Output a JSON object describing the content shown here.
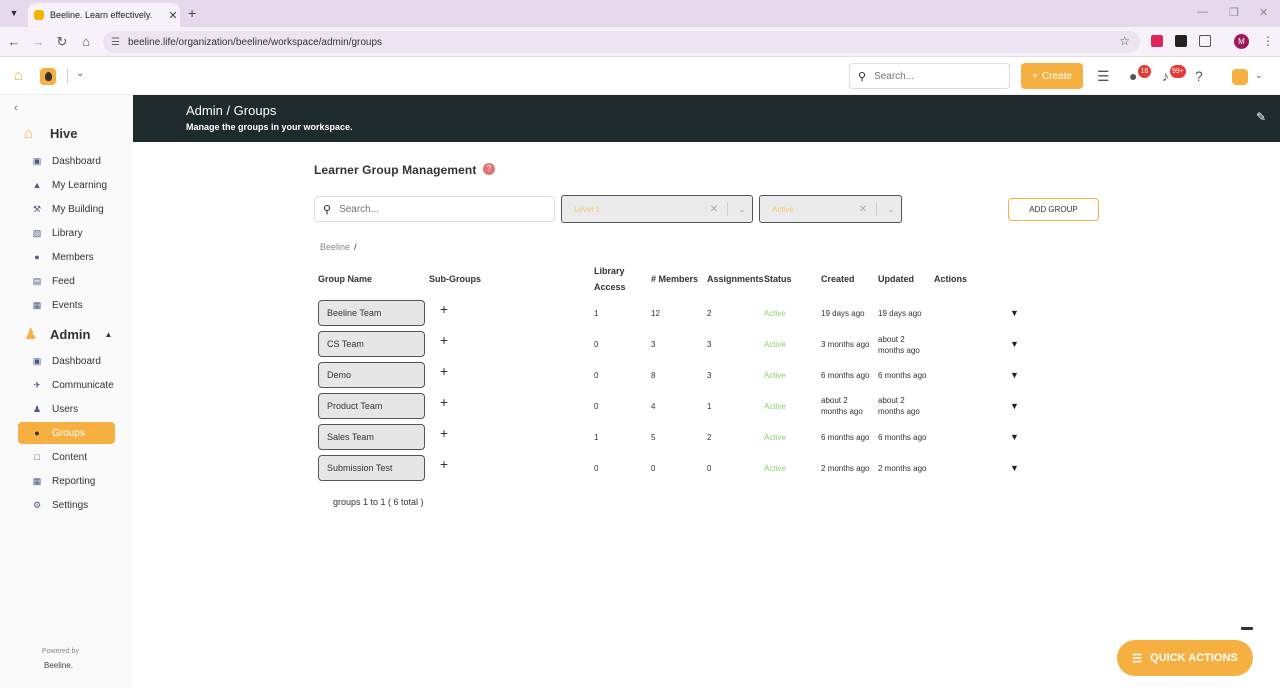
{
  "browser": {
    "tab_title": "Beeline. Learn effectively.",
    "url": "beeline.life/organization/beeline/workspace/admin/groups"
  },
  "header": {
    "search_placeholder": "Search...",
    "create_label": "Create",
    "notifications_badge": "16",
    "alerts_badge": "99+"
  },
  "sidebar": {
    "hive_label": "Hive",
    "hive_items": [
      {
        "label": "Dashboard",
        "icon": "chart-icon"
      },
      {
        "label": "My Learning",
        "icon": "graduation-cap-icon"
      },
      {
        "label": "My Building",
        "icon": "hammer-icon"
      },
      {
        "label": "Library",
        "icon": "book-icon"
      },
      {
        "label": "Members",
        "icon": "users-icon"
      },
      {
        "label": "Feed",
        "icon": "feed-icon"
      },
      {
        "label": "Events",
        "icon": "calendar-icon"
      }
    ],
    "admin_label": "Admin",
    "admin_items": [
      {
        "label": "Dashboard",
        "icon": "chart-icon"
      },
      {
        "label": "Communicate",
        "icon": "megaphone-icon"
      },
      {
        "label": "Users",
        "icon": "user-icon"
      },
      {
        "label": "Groups",
        "icon": "users-icon"
      },
      {
        "label": "Content",
        "icon": "file-icon"
      },
      {
        "label": "Reporting",
        "icon": "report-icon"
      },
      {
        "label": "Settings",
        "icon": "gear-icon"
      }
    ],
    "active_item": "Groups",
    "powered_by": "Powered by",
    "brand": "Beeline."
  },
  "banner": {
    "breadcrumb": "Admin  /  Groups",
    "subtitle": "Manage the groups in your workspace."
  },
  "main": {
    "title": "Learner Group Management",
    "search_placeholder": "Search...",
    "level_filter": "Level 1",
    "status_filter": "Active",
    "add_group_label": "ADD GROUP",
    "breadcrumb_root": "Beeline",
    "breadcrumb_sep": "/",
    "columns": {
      "group_name": "Group Name",
      "sub_groups": "Sub-Groups",
      "library_access_1": "Library",
      "library_access_2": "Access",
      "members": "# Members",
      "assignments": "Assignments",
      "status": "Status",
      "created": "Created",
      "updated": "Updated",
      "actions": "Actions"
    },
    "rows": [
      {
        "name": "Beeline Team",
        "library": "1",
        "members": "12",
        "assignments": "2",
        "status": "Active",
        "created": "19 days ago",
        "created2": "",
        "updated": "19 days ago",
        "updated2": ""
      },
      {
        "name": "CS Team",
        "library": "0",
        "members": "3",
        "assignments": "3",
        "status": "Active",
        "created": "3 months ago",
        "created2": "",
        "updated": "about 2",
        "updated2": "months ago"
      },
      {
        "name": "Demo",
        "library": "0",
        "members": "8",
        "assignments": "3",
        "status": "Active",
        "created": "6 months ago",
        "created2": "",
        "updated": "6 months ago",
        "updated2": ""
      },
      {
        "name": "Product Team",
        "library": "0",
        "members": "4",
        "assignments": "1",
        "status": "Active",
        "created": "about 2",
        "created2": "months ago",
        "updated": "about 2",
        "updated2": "months ago"
      },
      {
        "name": "Sales Team",
        "library": "1",
        "members": "5",
        "assignments": "2",
        "status": "Active",
        "created": "6 months ago",
        "created2": "",
        "updated": "6 months ago",
        "updated2": ""
      },
      {
        "name": "Submission Test",
        "library": "0",
        "members": "0",
        "assignments": "0",
        "status": "Active",
        "created": "2 months ago",
        "created2": "",
        "updated": "2 months ago",
        "updated2": ""
      }
    ],
    "pager": "groups 1 to 1 ( 6 total )"
  },
  "quick_actions_label": "QUICK ACTIONS",
  "colors": {
    "accent": "#f5b041",
    "banner": "#1e2a2c",
    "status_active": "#8bd36f"
  }
}
